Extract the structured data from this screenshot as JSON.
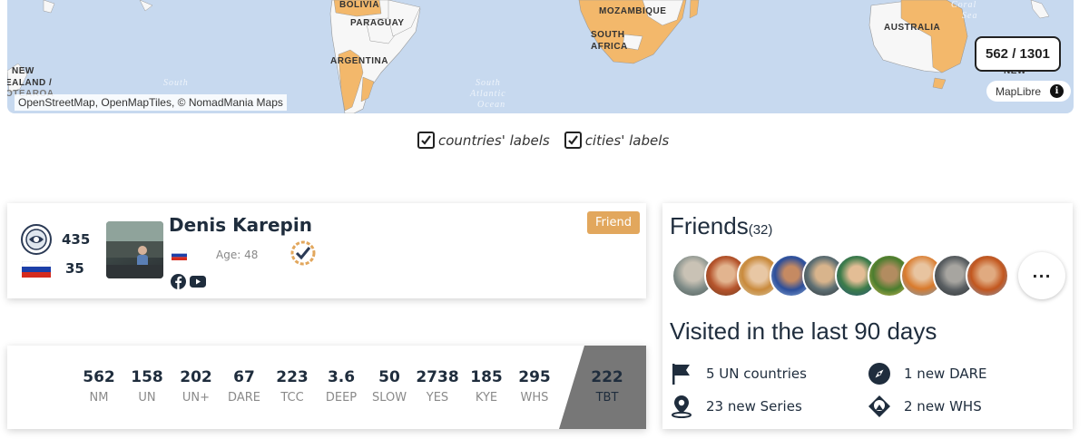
{
  "map": {
    "labels": {
      "bolivia": "BOLIVIA",
      "paraguay": "PARAGUAY",
      "argentina": "ARGENTINA",
      "mozambique": "MOZAMBIQUE",
      "south_africa_1": "SOUTH",
      "south_africa_2": "AFRICA",
      "australia": "AUSTRALIA",
      "nz_1": "NEW",
      "nz_2": "EALAND /",
      "nz_3": "OTEAROA",
      "nz_right": "NEW"
    },
    "ocean_labels": {
      "south_pacific": "South",
      "south_atlantic_1": "South",
      "south_atlantic_2": "Atlantic",
      "south_atlantic_3": "Ocean",
      "coral_1": "Coral",
      "coral_2": "Sea"
    },
    "attribution": "OpenStreetMap, OpenMapTiles, © NomadMania Maps",
    "counter": "562 / 1301",
    "maplibre_label": "MapLibre",
    "info_icon": "i"
  },
  "toggles": {
    "countries_label": "countries' labels",
    "countries_checked": true,
    "cities_label": "cities' labels",
    "cities_checked": true
  },
  "profile": {
    "nm_count": "435",
    "country_count": "35",
    "name": "Denis Karepin",
    "age": "Age: 48",
    "friend_button": "Friend",
    "flag_country": "Russia",
    "social_icons": [
      "facebook-icon",
      "youtube-icon"
    ]
  },
  "stats": [
    {
      "value": "562",
      "label": "NM"
    },
    {
      "value": "158",
      "label": "UN"
    },
    {
      "value": "202",
      "label": "UN+"
    },
    {
      "value": "67",
      "label": "DARE"
    },
    {
      "value": "223",
      "label": "TCC"
    },
    {
      "value": "3.6",
      "label": "DEEP"
    },
    {
      "value": "50",
      "label": "SLOW"
    },
    {
      "value": "2738",
      "label": "YES"
    },
    {
      "value": "185",
      "label": "KYE"
    },
    {
      "value": "295",
      "label": "WHS"
    },
    {
      "value": "222",
      "label": "TBT"
    }
  ],
  "friends": {
    "title": "Friends",
    "count": "(32)",
    "more": "···",
    "visited_title": "Visited in the last 90 days",
    "visited": [
      {
        "icon": "flag-icon",
        "text": "5 UN countries"
      },
      {
        "icon": "compass-icon",
        "text": "1 new DARE"
      },
      {
        "icon": "map-pin-icon",
        "text": "23 new Series"
      },
      {
        "icon": "whs-icon",
        "text": "2 new WHS"
      }
    ]
  },
  "colors": {
    "visited_land": "#f3b86b",
    "unvisited_land": "#f7f7f7",
    "ocean": "#c7d9ef",
    "friend_button": "#e2a75d",
    "dark_text": "#1f2d3d",
    "tbt_block": "#777777"
  }
}
